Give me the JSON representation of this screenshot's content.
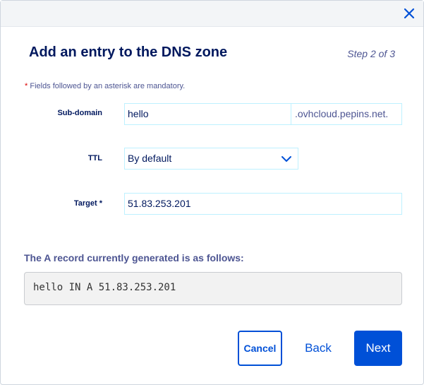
{
  "dialog": {
    "title": "Add an entry to the DNS zone",
    "step": "Step 2 of 3",
    "mandatory_star": "*",
    "mandatory_note": "Fields followed by an asterisk are mandatory."
  },
  "form": {
    "subdomain": {
      "label": "Sub-domain",
      "value": "hello",
      "suffix": ".ovhcloud.pepins.net."
    },
    "ttl": {
      "label": "TTL",
      "selected": "By default"
    },
    "target": {
      "label": "Target",
      "required_mark": "*",
      "value": "51.83.253.201"
    }
  },
  "record": {
    "heading": "The A record currently generated is as follows:",
    "value": "hello IN A 51.83.253.201"
  },
  "buttons": {
    "cancel": "Cancel",
    "back": "Back",
    "next": "Next"
  },
  "icons": {
    "close": "close-icon",
    "chevron": "chevron-down-icon"
  },
  "colors": {
    "primary": "#0050d7",
    "heading": "#00185e",
    "text": "#4d5592",
    "field_border": "#bef1ff",
    "required": "#db0000"
  }
}
